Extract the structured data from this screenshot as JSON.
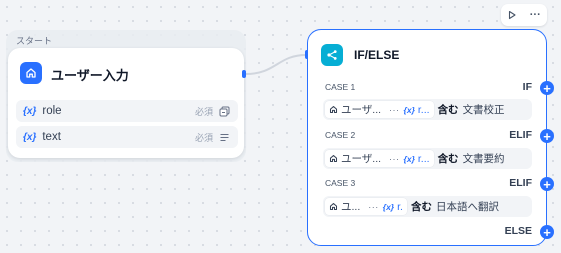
{
  "canvas": {
    "group_label": "スタート"
  },
  "start_node": {
    "title": "ユーザー入力",
    "icon": "home-icon",
    "variables": [
      {
        "brace": "{x}",
        "name": "role",
        "required": "必須",
        "type_icon": "select-list-icon"
      },
      {
        "brace": "{x}",
        "name": "text",
        "required": "必須",
        "type_icon": "paragraph-icon"
      }
    ]
  },
  "ifelse_node": {
    "title": "IF/ELSE",
    "icon": "branch-icon",
    "cases": [
      {
        "label": "CASE 1",
        "keyword": "IF",
        "source": "ユーザ...",
        "dots": "···",
        "var_brace": "{x}",
        "var": "r...",
        "operator": "含む",
        "value": "文書校正"
      },
      {
        "label": "CASE 2",
        "keyword": "ELIF",
        "source": "ユーザ...",
        "dots": "···",
        "var_brace": "{x}",
        "var": "r...",
        "operator": "含む",
        "value": "文書要約"
      },
      {
        "label": "CASE 3",
        "keyword": "ELIF",
        "source": "ユ...",
        "dots": "···",
        "var_brace": "{x}",
        "var": "r.",
        "operator": "含む",
        "value": "日本語へ翻訳"
      }
    ],
    "else_label": "ELSE",
    "add_symbol": "+"
  },
  "toolbar": {
    "run_icon": "play-icon",
    "more_icon": "more-horizontal-icon",
    "more_text": "···"
  },
  "colors": {
    "accent": "#2970ff",
    "branch_icon_bg": "#06aed4",
    "canvas_bg": "#f2f4f7"
  }
}
